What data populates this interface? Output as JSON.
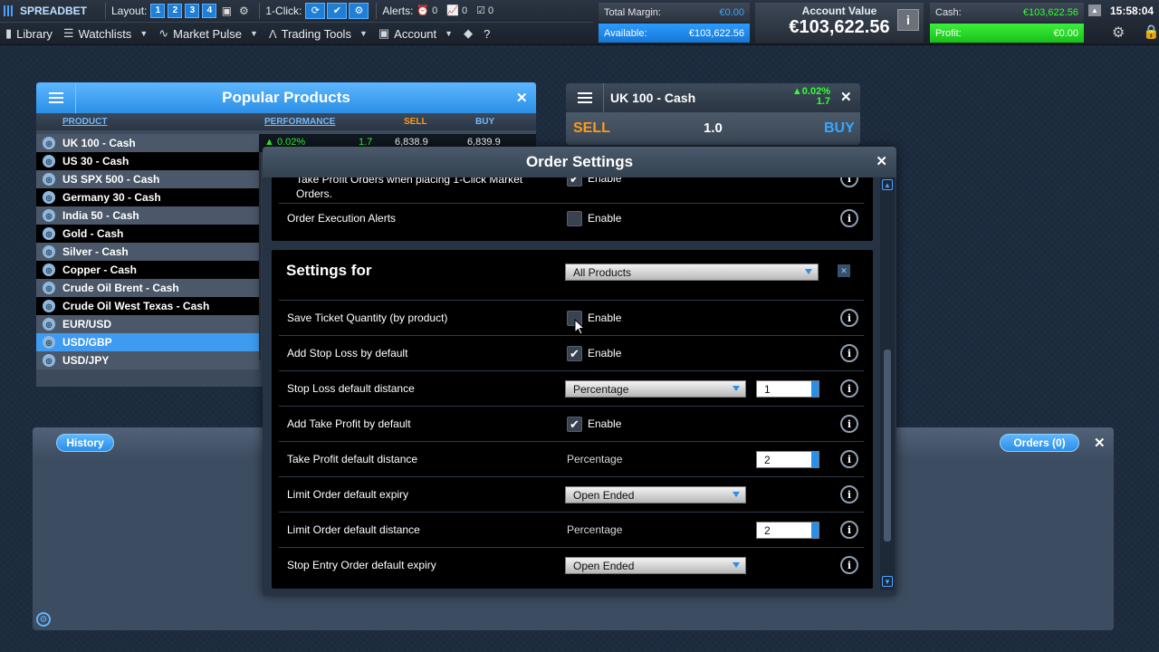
{
  "topbar": {
    "brand": "SPREADBET",
    "layout_label": "Layout:",
    "layout_buttons": [
      "1",
      "2",
      "3",
      "4"
    ],
    "one_click_label": "1-Click:",
    "alerts_label": "Alerts:",
    "alert_counts": [
      "0",
      "0",
      "0"
    ],
    "nav": [
      {
        "label": "Library",
        "icon": "book-icon"
      },
      {
        "label": "Watchlists",
        "icon": "list-icon"
      },
      {
        "label": "Market Pulse",
        "icon": "pulse-icon"
      },
      {
        "label": "Trading Tools",
        "icon": "compass-icon"
      },
      {
        "label": "Account",
        "icon": "account-icon"
      }
    ],
    "help": "?",
    "total_margin_label": "Total Margin:",
    "total_margin_value": "€0.00",
    "available_label": "Available:",
    "available_value": "€103,622.56",
    "account_value_label": "Account Value",
    "account_value": "€103,622.56",
    "info_letter": "i",
    "cash_label": "Cash:",
    "cash_value": "€103,622.56",
    "profit_label": "Profit:",
    "profit_value": "€0.00",
    "clock": "15:58:04"
  },
  "popular": {
    "title": "Popular Products",
    "columns": {
      "product": "PRODUCT",
      "performance": "PERFORMANCE",
      "sell": "SELL",
      "buy": "BUY"
    },
    "items": [
      "UK 100 - Cash",
      "US 30 - Cash",
      "US SPX 500 - Cash",
      "Germany 30 - Cash",
      "India 50 - Cash",
      "Gold - Cash",
      "Silver - Cash",
      "Copper - Cash",
      "Crude Oil Brent - Cash",
      "Crude Oil West Texas - Cash",
      "EUR/USD",
      "USD/GBP",
      "USD/JPY"
    ],
    "first_row": {
      "perf": "0.02%",
      "points": "1.7",
      "sell": "6,838.9",
      "buy": "6,839.9"
    }
  },
  "uk_panel": {
    "title": "UK 100 - Cash",
    "perf_pct": "0.02%",
    "perf_pts": "1.7",
    "sell": "SELL",
    "qty": "1.0",
    "buy": "BUY"
  },
  "bottom": {
    "history_tab": "History",
    "orders_tab": "Orders (0)"
  },
  "dialog": {
    "title": "Order Settings",
    "top_rows": [
      {
        "label": "Take Profit Orders when placing 1-Click Market Orders.",
        "checked": true,
        "enable": "Enable"
      },
      {
        "label": "Order Execution Alerts",
        "checked": false,
        "enable": "Enable"
      }
    ],
    "settings_for_label": "Settings for",
    "settings_for_value": "All Products",
    "rows": [
      {
        "label": "Save Ticket Quantity (by product)",
        "type": "checkbox",
        "checked": false,
        "enable": "Enable"
      },
      {
        "label": "Add Stop Loss by default",
        "type": "checkbox",
        "checked": true,
        "enable": "Enable"
      },
      {
        "label": "Stop Loss default distance",
        "type": "dropdown-num",
        "value": "Percentage",
        "num": "1"
      },
      {
        "label": "Add Take Profit by default",
        "type": "checkbox",
        "checked": true,
        "enable": "Enable"
      },
      {
        "label": "Take Profit default distance",
        "type": "plain-num",
        "value": "Percentage",
        "num": "2"
      },
      {
        "label": "Limit Order default expiry",
        "type": "dropdown",
        "value": "Open Ended"
      },
      {
        "label": "Limit Order default distance",
        "type": "plain-num",
        "value": "Percentage",
        "num": "2"
      },
      {
        "label": "Stop Entry Order default expiry",
        "type": "dropdown",
        "value": "Open Ended"
      }
    ]
  }
}
